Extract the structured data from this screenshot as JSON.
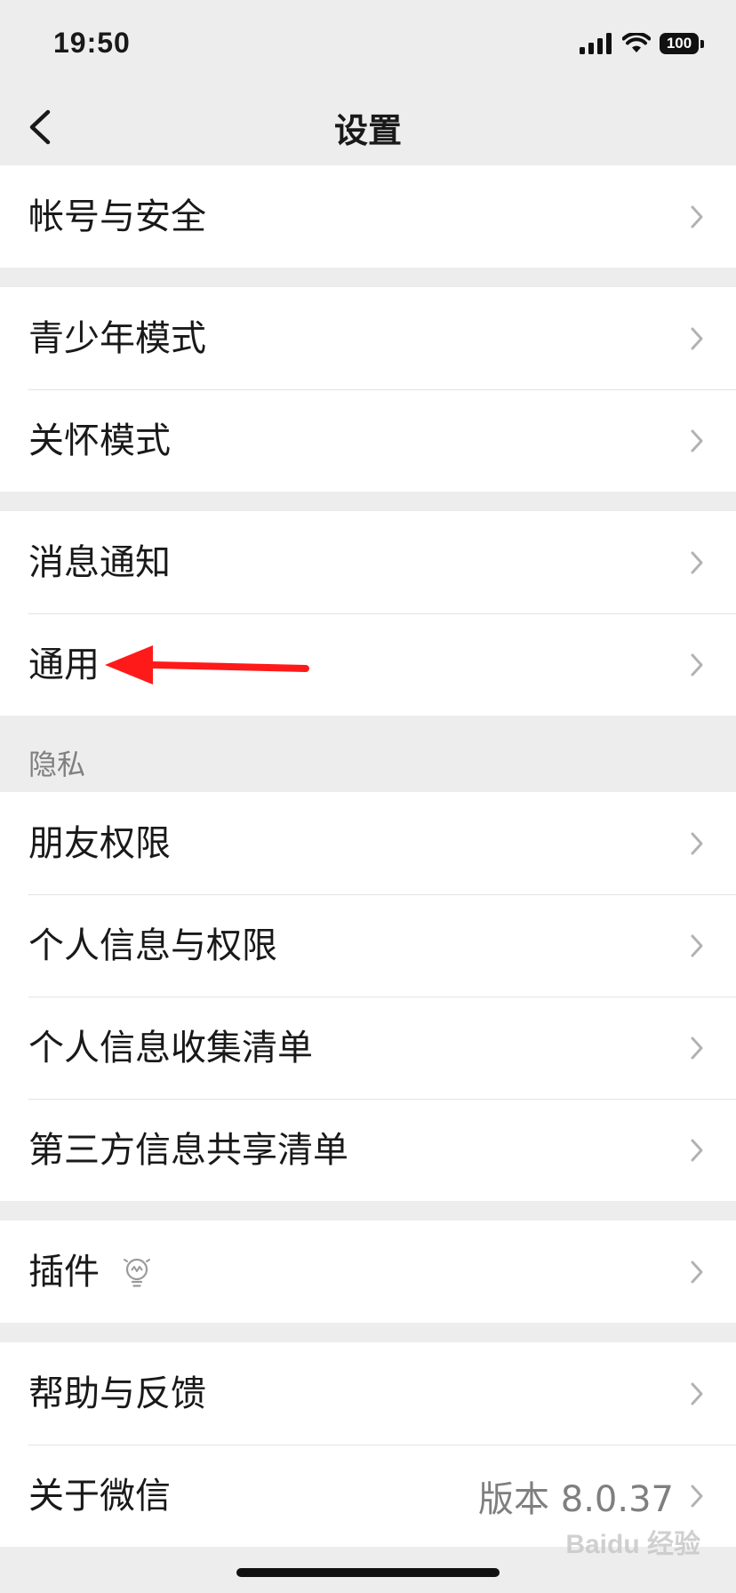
{
  "status_bar": {
    "time": "19:50",
    "battery": "100"
  },
  "nav": {
    "title": "设置"
  },
  "groups": [
    {
      "items": [
        {
          "label": "帐号与安全"
        }
      ]
    },
    {
      "items": [
        {
          "label": "青少年模式"
        },
        {
          "label": "关怀模式"
        }
      ]
    },
    {
      "items": [
        {
          "label": "消息通知"
        },
        {
          "label": "通用"
        }
      ]
    },
    {
      "section_label": "隐私",
      "items": [
        {
          "label": "朋友权限"
        },
        {
          "label": "个人信息与权限"
        },
        {
          "label": "个人信息收集清单"
        },
        {
          "label": "第三方信息共享清单"
        }
      ]
    },
    {
      "items": [
        {
          "label": "插件"
        }
      ]
    },
    {
      "items": [
        {
          "label": "帮助与反馈"
        },
        {
          "label": "关于微信",
          "value": "版本 8.0.37"
        }
      ]
    }
  ],
  "watermark": "Baidu 经验",
  "colors": {
    "background": "#ededed",
    "row_bg": "#ffffff",
    "annotation_arrow": "#ff1a1a"
  }
}
